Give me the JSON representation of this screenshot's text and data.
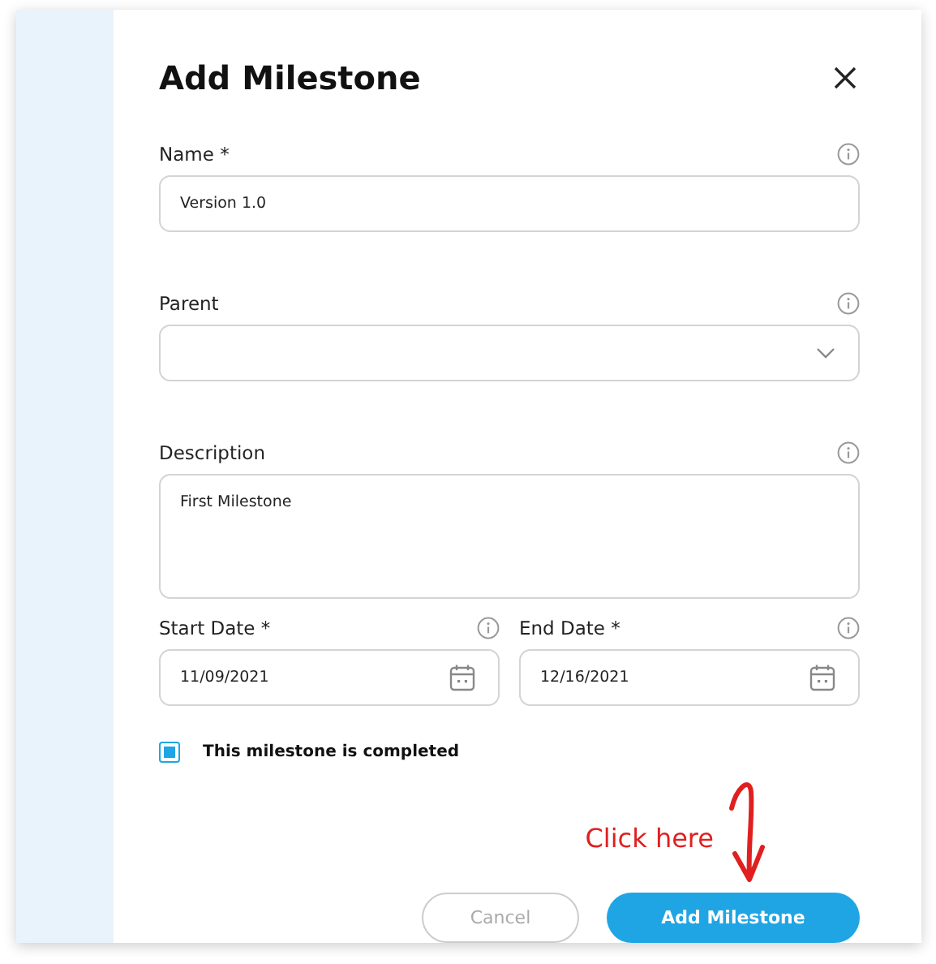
{
  "dialog": {
    "title": "Add Milestone"
  },
  "fields": [
    {
      "kind": "text",
      "label": "Name *",
      "value": "Version 1.0"
    },
    {
      "kind": "select",
      "label": "Parent"
    },
    {
      "kind": "textarea",
      "label": "Description",
      "value": "First Milestone"
    }
  ],
  "dates": [
    {
      "label": "Start Date *",
      "value": "11/09/2021"
    },
    {
      "label": "End Date *",
      "value": "12/16/2021"
    }
  ],
  "completed": {
    "label": "This milestone is completed",
    "checked": true
  },
  "annotation": {
    "text": "Click here"
  },
  "buttons": [
    {
      "label": "Cancel",
      "kind": "secondary"
    },
    {
      "label": "Add Milestone",
      "kind": "primary"
    }
  ]
}
